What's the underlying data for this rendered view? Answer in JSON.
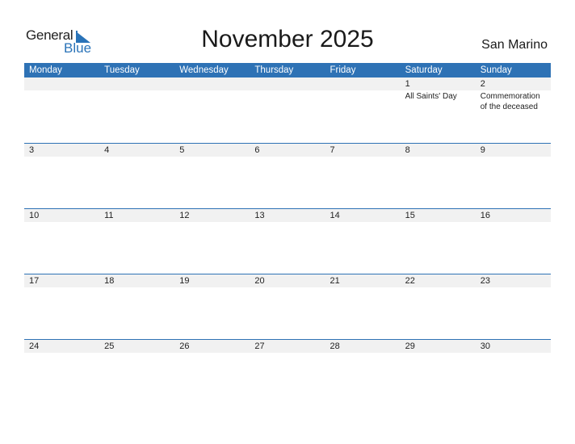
{
  "logo": {
    "general": "General",
    "blue": "Blue"
  },
  "title": "November 2025",
  "country": "San Marino",
  "colors": {
    "accent": "#2e72b5",
    "date_strip": "#f1f1f1"
  },
  "weekdays": [
    "Monday",
    "Tuesday",
    "Wednesday",
    "Thursday",
    "Friday",
    "Saturday",
    "Sunday"
  ],
  "weeks": [
    [
      {
        "day": ""
      },
      {
        "day": ""
      },
      {
        "day": ""
      },
      {
        "day": ""
      },
      {
        "day": ""
      },
      {
        "day": "1",
        "holiday": "All Saints' Day"
      },
      {
        "day": "2",
        "holiday": "Commemoration of the deceased"
      }
    ],
    [
      {
        "day": "3"
      },
      {
        "day": "4"
      },
      {
        "day": "5"
      },
      {
        "day": "6"
      },
      {
        "day": "7"
      },
      {
        "day": "8"
      },
      {
        "day": "9"
      }
    ],
    [
      {
        "day": "10"
      },
      {
        "day": "11"
      },
      {
        "day": "12"
      },
      {
        "day": "13"
      },
      {
        "day": "14"
      },
      {
        "day": "15"
      },
      {
        "day": "16"
      }
    ],
    [
      {
        "day": "17"
      },
      {
        "day": "18"
      },
      {
        "day": "19"
      },
      {
        "day": "20"
      },
      {
        "day": "21"
      },
      {
        "day": "22"
      },
      {
        "day": "23"
      }
    ],
    [
      {
        "day": "24"
      },
      {
        "day": "25"
      },
      {
        "day": "26"
      },
      {
        "day": "27"
      },
      {
        "day": "28"
      },
      {
        "day": "29"
      },
      {
        "day": "30"
      }
    ]
  ]
}
